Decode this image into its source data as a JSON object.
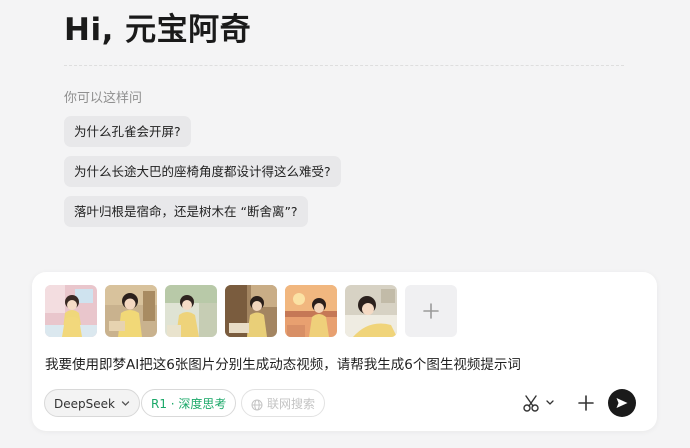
{
  "greeting": "Hi, 元宝阿奇",
  "hint": "你可以这样问",
  "suggestions": [
    {
      "label": "为什么孔雀会开屏?"
    },
    {
      "label": "为什么长途大巴的座椅角度都设计得这么难受?"
    },
    {
      "label": "落叶归根是宿命，还是树木在 “断舍离”?"
    }
  ],
  "composer": {
    "prompt_text": "我要使用即梦AI把这6张图片分别生成动态视频，请帮我生成6个图生视频提示词",
    "images": [
      {
        "name": "attached-image-1"
      },
      {
        "name": "attached-image-2"
      },
      {
        "name": "attached-image-3"
      },
      {
        "name": "attached-image-4"
      },
      {
        "name": "attached-image-5"
      },
      {
        "name": "attached-image-6"
      }
    ],
    "add_icon": "plus-icon",
    "model_label": "DeepSeek",
    "r1_label": "R1 · 深度思考",
    "web_label": "联网搜索",
    "colors": {
      "r1_accent": "#1aa868",
      "send_bg": "#1a1a1a"
    }
  }
}
